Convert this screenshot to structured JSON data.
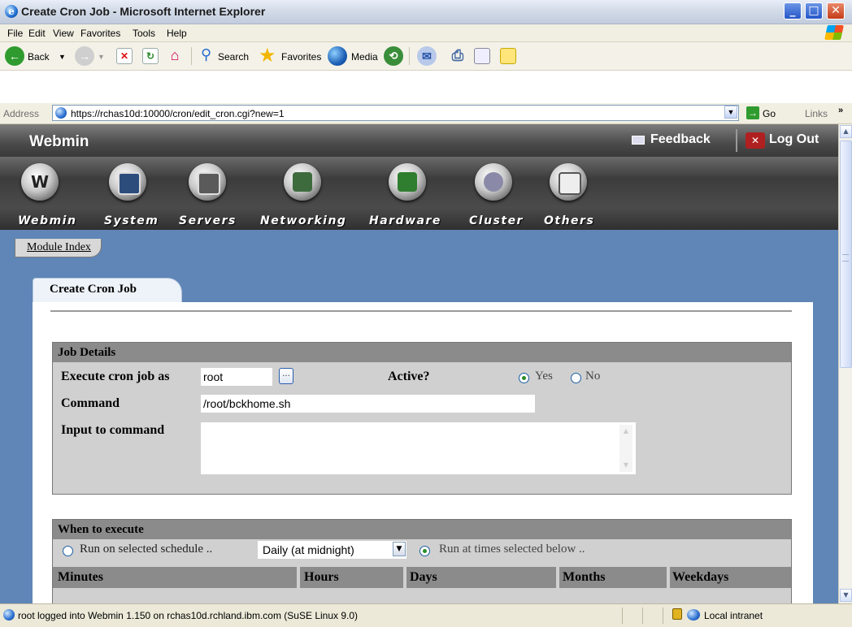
{
  "window": {
    "title": "Create Cron Job - Microsoft Internet Explorer"
  },
  "menu": [
    "File",
    "Edit",
    "View",
    "Favorites",
    "Tools",
    "Help"
  ],
  "toolbar": {
    "back": "Back",
    "search": "Search",
    "favorites": "Favorites",
    "media": "Media"
  },
  "address": {
    "label": "Address",
    "url": "https://rchas10d:10000/cron/edit_cron.cgi?new=1",
    "go": "Go",
    "links": "Links"
  },
  "webmin": {
    "logo": "Webmin",
    "feedback": "Feedback",
    "logout": "Log Out",
    "categories": [
      "Webmin",
      "System",
      "Servers",
      "Networking",
      "Hardware",
      "Cluster",
      "Others"
    ],
    "module_index": "Module Index"
  },
  "page": {
    "tab_title": "Create Cron Job"
  },
  "job_details": {
    "heading": "Job Details",
    "execute_as_label": "Execute cron job as",
    "execute_as_value": "root",
    "browse": "...",
    "active_label": "Active?",
    "active_yes": "Yes",
    "active_no": "No",
    "active_selected": "Yes",
    "command_label": "Command",
    "command_value": "/root/bckhome.sh",
    "input_label": "Input to command",
    "input_value": ""
  },
  "when": {
    "heading": "When to execute",
    "opt_schedule": "Run on selected schedule ..",
    "schedule_value": "Daily (at midnight)",
    "opt_times": "Run at times selected below ..",
    "selected": "times",
    "columns": [
      "Minutes",
      "Hours",
      "Days",
      "Months",
      "Weekdays"
    ]
  },
  "status": {
    "message": "root logged into Webmin 1.150 on rchas10d.rchland.ibm.com (SuSE Linux 9.0)",
    "zone": "Local intranet"
  }
}
